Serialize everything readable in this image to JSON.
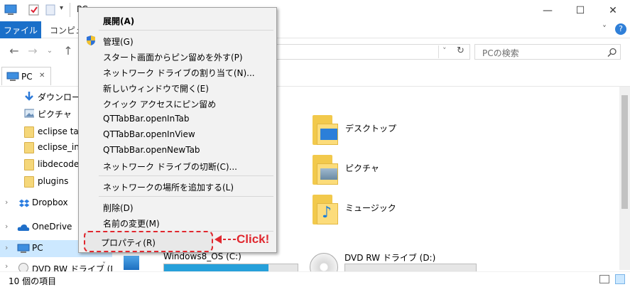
{
  "window": {
    "title_partial": "PC",
    "controls": {
      "minimize": "—",
      "maximize": "☐",
      "close": "✕"
    }
  },
  "ribbon": {
    "file_tab": "ファイル",
    "tab_computer": "コンピュー",
    "expand_caret": "˅",
    "help": "?"
  },
  "address": {
    "refresh": "↻",
    "search_placeholder": "PCの検索"
  },
  "tabbar": {
    "pc_tab_label": "PC",
    "pc_tab_close": "✕"
  },
  "nav_pane": {
    "items": [
      {
        "label": "ダウンロード",
        "icon": "download-icon"
      },
      {
        "label": "ピクチャ",
        "icon": "pictures-icon"
      },
      {
        "label": "eclipse tag",
        "icon": "folder-icon"
      },
      {
        "label": "eclipse_ins",
        "icon": "folder-icon"
      },
      {
        "label": "libdecoder",
        "icon": "folder-icon"
      },
      {
        "label": "plugins",
        "icon": "folder-icon"
      },
      {
        "label": "Dropbox",
        "icon": "dropbox-icon"
      },
      {
        "label": "OneDrive",
        "icon": "onedrive-icon"
      },
      {
        "label": "PC",
        "icon": "pc-icon"
      },
      {
        "label": "DVD RW ドライブ (D",
        "icon": "dvd-icon"
      }
    ]
  },
  "content": {
    "folders": [
      {
        "label": "デスクトップ"
      },
      {
        "label": "ピクチャ"
      },
      {
        "label": "ミュージック"
      }
    ],
    "drives": [
      {
        "label": "Windows8_OS (C:)",
        "usage_fraction": 0.78
      },
      {
        "label": "DVD RW ドライブ (D:)"
      }
    ]
  },
  "status": {
    "item_count": "10 個の項目"
  },
  "context_menu": {
    "items": [
      {
        "label": "展開(A)",
        "bold": true
      },
      {
        "label": "管理(G)",
        "icon": "shield-icon"
      },
      {
        "label": "スタート画面からピン留めを外す(P)"
      },
      {
        "label": "ネットワーク ドライブの割り当て(N)..."
      },
      {
        "label": "新しいウィンドウで開く(E)"
      },
      {
        "label": "クイック アクセスにピン留め"
      },
      {
        "label": "QTTabBar.openInTab"
      },
      {
        "label": "QTTabBar.openInView"
      },
      {
        "label": "QTTabBar.openNewTab"
      },
      {
        "label": "ネットワーク ドライブの切断(C)..."
      },
      {
        "label": "ネットワークの場所を追加する(L)"
      },
      {
        "label": "削除(D)"
      },
      {
        "label": "名前の変更(M)"
      },
      {
        "label": "プロパティ(R)"
      }
    ]
  },
  "annotation": {
    "click_label": "Click!",
    "color": "#e0282f"
  },
  "colors": {
    "accent": "#1a6fc9",
    "selection": "#cce8ff",
    "drive_bar": "#26a0da"
  }
}
